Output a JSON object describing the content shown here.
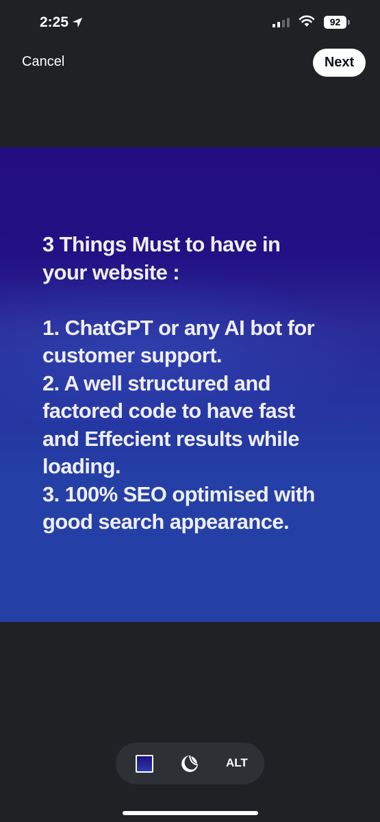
{
  "status_bar": {
    "time": "2:25",
    "location_icon": "location-arrow-icon",
    "signal_icon": "cellular-signal-icon",
    "wifi_icon": "wifi-icon",
    "battery_level": "92"
  },
  "header": {
    "cancel_label": "Cancel",
    "next_label": "Next"
  },
  "media": {
    "background_colors": [
      "#220e80",
      "#2440a6"
    ],
    "lines": [
      "3 Things Must to have in",
      "your website :",
      "",
      "1. ChatGPT or any AI bot for",
      "customer support.",
      "2. A well structured and",
      "factored code to have fast",
      "and Effecient results while",
      "loading.",
      "3. 100% SEO optimised with",
      "good search appearance."
    ]
  },
  "toolbar": {
    "media_icon": "image-thumbnail-icon",
    "sticker_icon": "sticker-icon",
    "alt_label": "ALT"
  }
}
